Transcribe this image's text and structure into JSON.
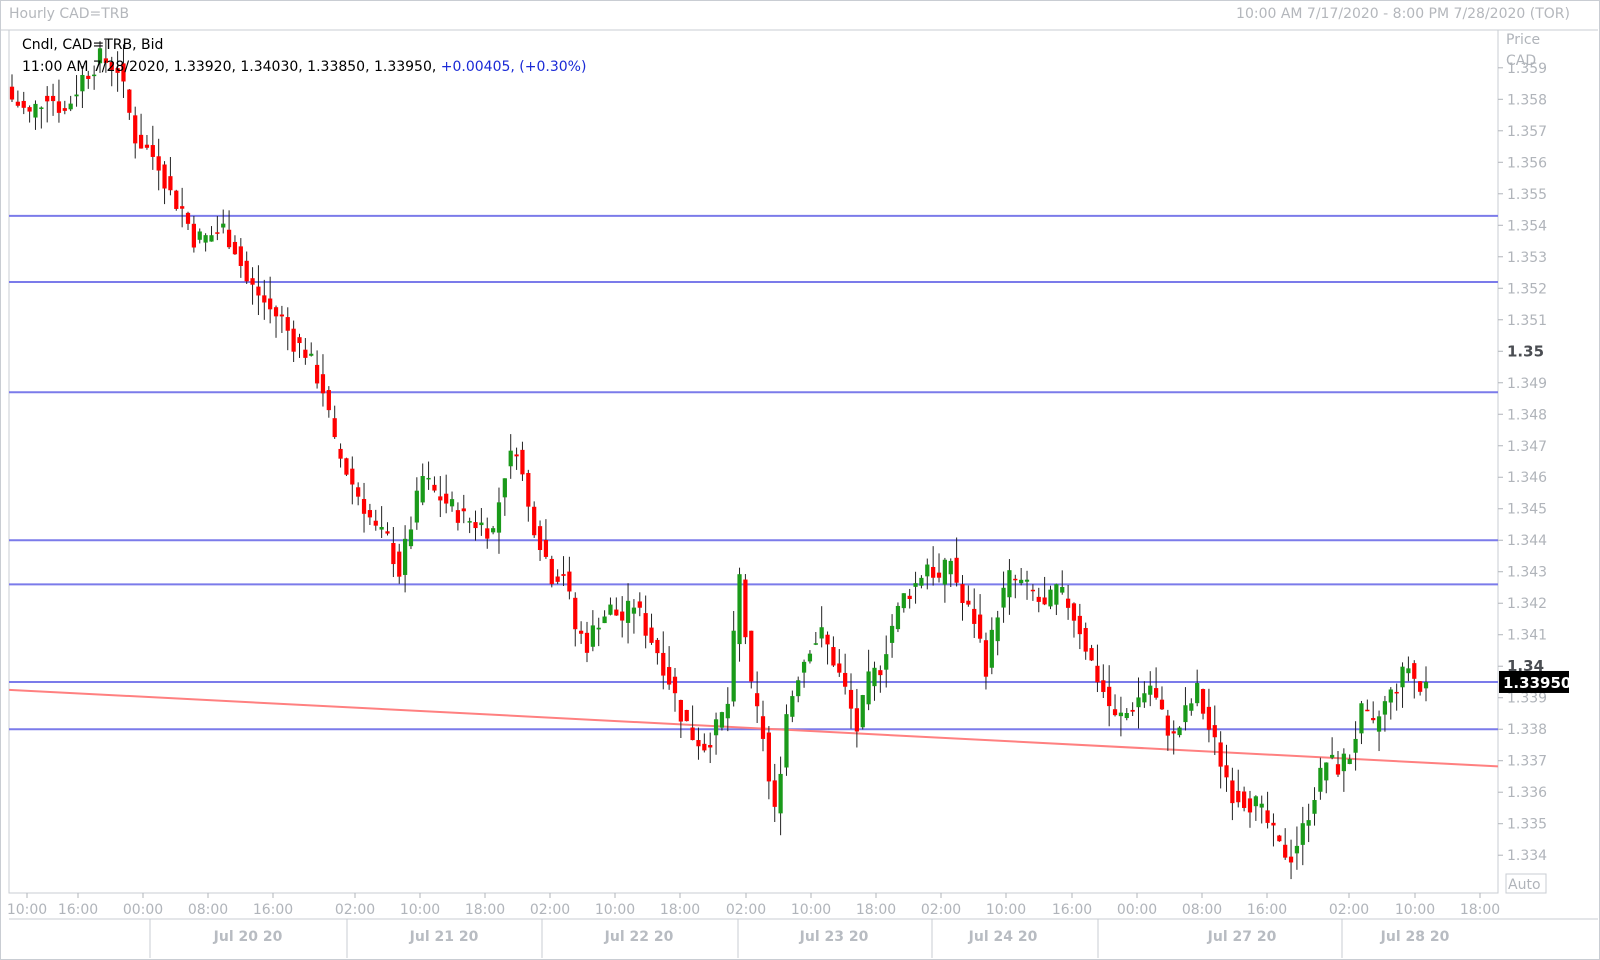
{
  "header": {
    "title": "Hourly CAD=TRB",
    "range": "10:00 AM 7/17/2020 - 8:00 PM 7/28/2020 (TOR)"
  },
  "legend": {
    "line1": "Cndl, CAD=TRB, Bid",
    "line2_prefix": "11:00 AM 7/28/2020, 1.33920, 1.34030, 1.33850, 1.33950,",
    "line2_change": "+0.00405, (+0.30%)"
  },
  "axis": {
    "price_title_1": "Price",
    "price_title_2": "CAD",
    "auto_label": "Auto",
    "last_price": "1.33950"
  },
  "chart_data": {
    "type": "candlestick",
    "ylim": [
      1.3328,
      1.3602
    ],
    "price_ticks": [
      "1.359",
      "1.358",
      "1.357",
      "1.356",
      "1.355",
      "1.354",
      "1.353",
      "1.352",
      "1.351",
      "1.35",
      "1.349",
      "1.348",
      "1.347",
      "1.346",
      "1.345",
      "1.344",
      "1.343",
      "1.342",
      "1.341",
      "1.34",
      "1.339",
      "1.338",
      "1.337",
      "1.336",
      "1.335",
      "1.334"
    ],
    "time_ticks": [
      "10:00",
      "16:00",
      "00:00",
      "08:00",
      "16:00",
      "02:00",
      "10:00",
      "18:00",
      "02:00",
      "10:00",
      "18:00",
      "02:00",
      "10:00",
      "18:00",
      "02:00",
      "10:00",
      "16:00",
      "00:00",
      "08:00",
      "16:00",
      "02:00",
      "10:00",
      "18:00"
    ],
    "date_labels": [
      "Jul 20 20",
      "Jul 21 20",
      "Jul 22 20",
      "Jul 23 20",
      "Jul 24 20",
      "Jul 27 20",
      "Jul 28 20"
    ],
    "horizontal_levels": [
      1.3543,
      1.3522,
      1.3487,
      1.344,
      1.3426,
      1.3395,
      1.338
    ],
    "trendline": {
      "start": 1.33925,
      "end": 1.33682,
      "color": "#ff8080"
    },
    "level_color": "#7b7bea",
    "up_color": "#1a9a1a",
    "down_color": "#ff0000",
    "anchors": [
      [
        0,
        1.358
      ],
      [
        3,
        1.3575
      ],
      [
        6,
        1.3582
      ],
      [
        9,
        1.3576
      ],
      [
        12,
        1.3587
      ],
      [
        15,
        1.3593
      ],
      [
        18,
        1.359
      ],
      [
        21,
        1.3568
      ],
      [
        25,
        1.356
      ],
      [
        27,
        1.355
      ],
      [
        29,
        1.3545
      ],
      [
        31,
        1.3536
      ],
      [
        33,
        1.3536
      ],
      [
        36,
        1.3539
      ],
      [
        38,
        1.3533
      ],
      [
        40,
        1.3522
      ],
      [
        42,
        1.3518
      ],
      [
        44,
        1.3513
      ],
      [
        46,
        1.351
      ],
      [
        48,
        1.3503
      ],
      [
        50,
        1.35
      ],
      [
        53,
        1.3488
      ],
      [
        55,
        1.347
      ],
      [
        58,
        1.3458
      ],
      [
        60,
        1.3451
      ],
      [
        62,
        1.3443
      ],
      [
        64,
        1.344
      ],
      [
        66,
        1.343
      ],
      [
        68,
        1.3445
      ],
      [
        70,
        1.346
      ],
      [
        72,
        1.3455
      ],
      [
        74,
        1.3452
      ],
      [
        77,
        1.3447
      ],
      [
        80,
        1.3445
      ],
      [
        82,
        1.3443
      ],
      [
        84,
        1.3462
      ],
      [
        86,
        1.347
      ],
      [
        88,
        1.345
      ],
      [
        90,
        1.344
      ],
      [
        92,
        1.3429
      ],
      [
        94,
        1.343
      ],
      [
        96,
        1.3412
      ],
      [
        98,
        1.3407
      ],
      [
        100,
        1.3415
      ],
      [
        102,
        1.3418
      ],
      [
        104,
        1.3415
      ],
      [
        106,
        1.342
      ],
      [
        108,
        1.3412
      ],
      [
        110,
        1.3405
      ],
      [
        112,
        1.3396
      ],
      [
        114,
        1.3385
      ],
      [
        116,
        1.3378
      ],
      [
        118,
        1.3375
      ],
      [
        120,
        1.338
      ],
      [
        122,
        1.3388
      ],
      [
        124,
        1.3428
      ],
      [
        126,
        1.3392
      ],
      [
        128,
        1.3378
      ],
      [
        129,
        1.3363
      ],
      [
        130,
        1.3353
      ],
      [
        132,
        1.3385
      ],
      [
        134,
        1.3398
      ],
      [
        136,
        1.3407
      ],
      [
        138,
        1.341
      ],
      [
        140,
        1.3402
      ],
      [
        142,
        1.3392
      ],
      [
        144,
        1.338
      ],
      [
        146,
        1.3395
      ],
      [
        148,
        1.34
      ],
      [
        150,
        1.3413
      ],
      [
        152,
        1.3422
      ],
      [
        154,
        1.3426
      ],
      [
        156,
        1.3433
      ],
      [
        158,
        1.3427
      ],
      [
        160,
        1.3434
      ],
      [
        162,
        1.342
      ],
      [
        164,
        1.3415
      ],
      [
        166,
        1.34
      ],
      [
        168,
        1.3418
      ],
      [
        170,
        1.3428
      ],
      [
        172,
        1.3426
      ],
      [
        174,
        1.3423
      ],
      [
        176,
        1.3418
      ],
      [
        178,
        1.3424
      ],
      [
        180,
        1.342
      ],
      [
        182,
        1.3412
      ],
      [
        184,
        1.3401
      ],
      [
        186,
        1.3392
      ],
      [
        188,
        1.3383
      ],
      [
        190,
        1.3385
      ],
      [
        192,
        1.339
      ],
      [
        194,
        1.3394
      ],
      [
        196,
        1.3384
      ],
      [
        198,
        1.3377
      ],
      [
        200,
        1.3385
      ],
      [
        202,
        1.3392
      ],
      [
        204,
        1.338
      ],
      [
        206,
        1.337
      ],
      [
        208,
        1.336
      ],
      [
        210,
        1.3358
      ],
      [
        212,
        1.3356
      ],
      [
        214,
        1.335
      ],
      [
        216,
        1.3342
      ],
      [
        218,
        1.334
      ],
      [
        220,
        1.3348
      ],
      [
        222,
        1.336
      ],
      [
        224,
        1.337
      ],
      [
        226,
        1.3368
      ],
      [
        228,
        1.3372
      ],
      [
        230,
        1.3385
      ],
      [
        232,
        1.338
      ],
      [
        234,
        1.3388
      ],
      [
        236,
        1.3394
      ],
      [
        238,
        1.34
      ],
      [
        240,
        1.3392
      ],
      [
        241,
        1.3395
      ]
    ]
  }
}
